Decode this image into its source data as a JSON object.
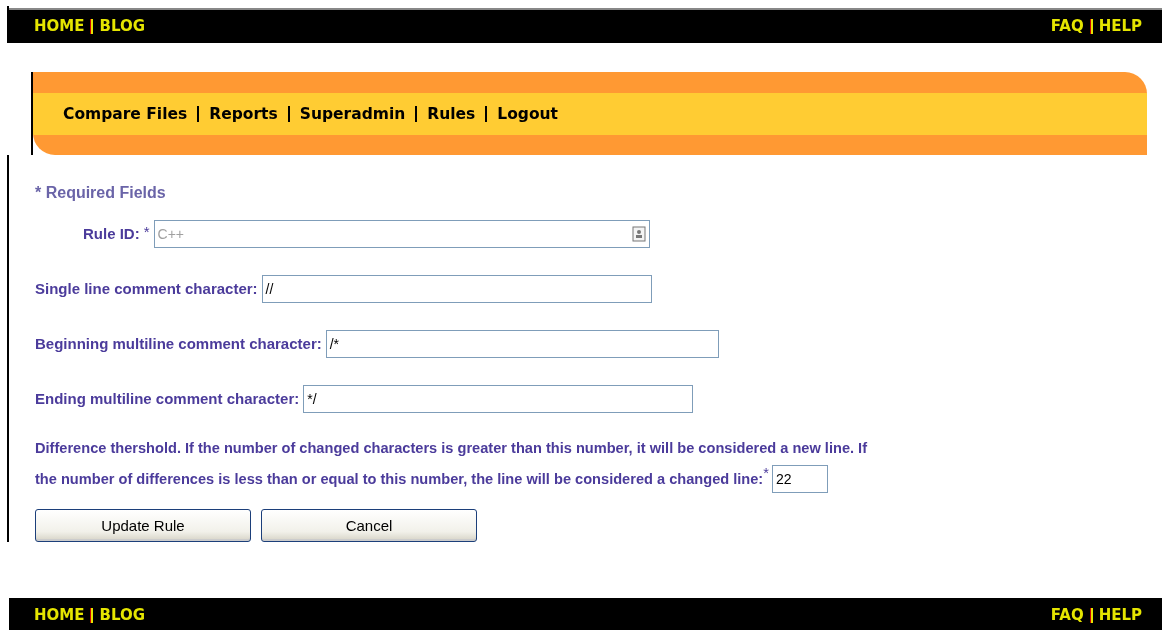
{
  "top_bar": {
    "left_links": [
      "HOME",
      "BLOG"
    ],
    "right_links": [
      "FAQ",
      "HELP"
    ]
  },
  "menu": {
    "items": [
      "Compare Files",
      "Reports",
      "Superadmin",
      "Rules",
      "Logout"
    ]
  },
  "required_note": "* Required Fields",
  "fields": [
    {
      "label": "Rule ID:",
      "required_mark": "*",
      "value": "C++",
      "disabled": true
    },
    {
      "label": "Single line comment character:",
      "value": "//",
      "disabled": false
    },
    {
      "label": "Beginning multiline comment character:",
      "value": "/*",
      "disabled": false
    },
    {
      "label": "Ending multiline comment character:",
      "value": "*/",
      "disabled": false
    }
  ],
  "threshold": {
    "lines": [
      "Difference thershold. If the number of changed characters is greater than this number, it will be considered a new line. If",
      "the number of differences is less than or equal to this number, the line will be considered a changed line:"
    ],
    "required_mark": "*",
    "value": "22"
  },
  "buttons": [
    "Update Rule",
    "Cancel"
  ],
  "bottom_bar": {
    "left_links": [
      "HOME",
      "BLOG"
    ],
    "right_links": [
      "FAQ",
      "HELP"
    ]
  }
}
